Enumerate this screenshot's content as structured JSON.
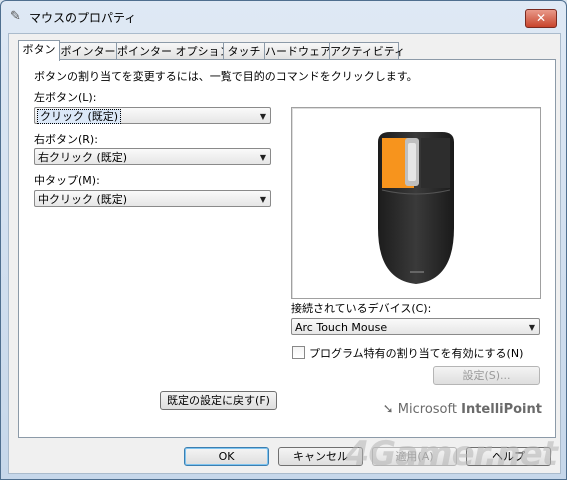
{
  "window": {
    "title": "マウスのプロパティ",
    "close_label": "✕"
  },
  "tabs": [
    {
      "label": "ボタン",
      "active": true
    },
    {
      "label": "ポインター"
    },
    {
      "label": "ポインター オプション"
    },
    {
      "label": "タッチ"
    },
    {
      "label": "ハードウェア"
    },
    {
      "label": "アクティビティ"
    }
  ],
  "buttons_tab": {
    "description": "ボタンの割り当てを変更するには、一覧で目的のコマンドをクリックします。",
    "left_label": "左ボタン(L):",
    "left_value": "クリック (既定)",
    "right_label": "右ボタン(R):",
    "right_value": "右クリック (既定)",
    "middle_label": "中タップ(M):",
    "middle_value": "中クリック (既定)",
    "connected_label": "接続されているデバイス(C):",
    "connected_value": "Arc Touch Mouse",
    "program_specific_label": "プログラム特有の割り当てを有効にする(N)",
    "program_specific_checked": false,
    "settings_button": "設定(S)...",
    "reset_button": "既定の設定に戻す(F)",
    "brand_prefix": "Microsoft",
    "brand_name": "IntelliPoint",
    "highlight_color": "#f7941d"
  },
  "dialog_buttons": {
    "ok": "OK",
    "cancel": "キャンセル",
    "apply": "適用(A)",
    "help": "ヘルプ"
  },
  "watermark": "4Gamer.net"
}
